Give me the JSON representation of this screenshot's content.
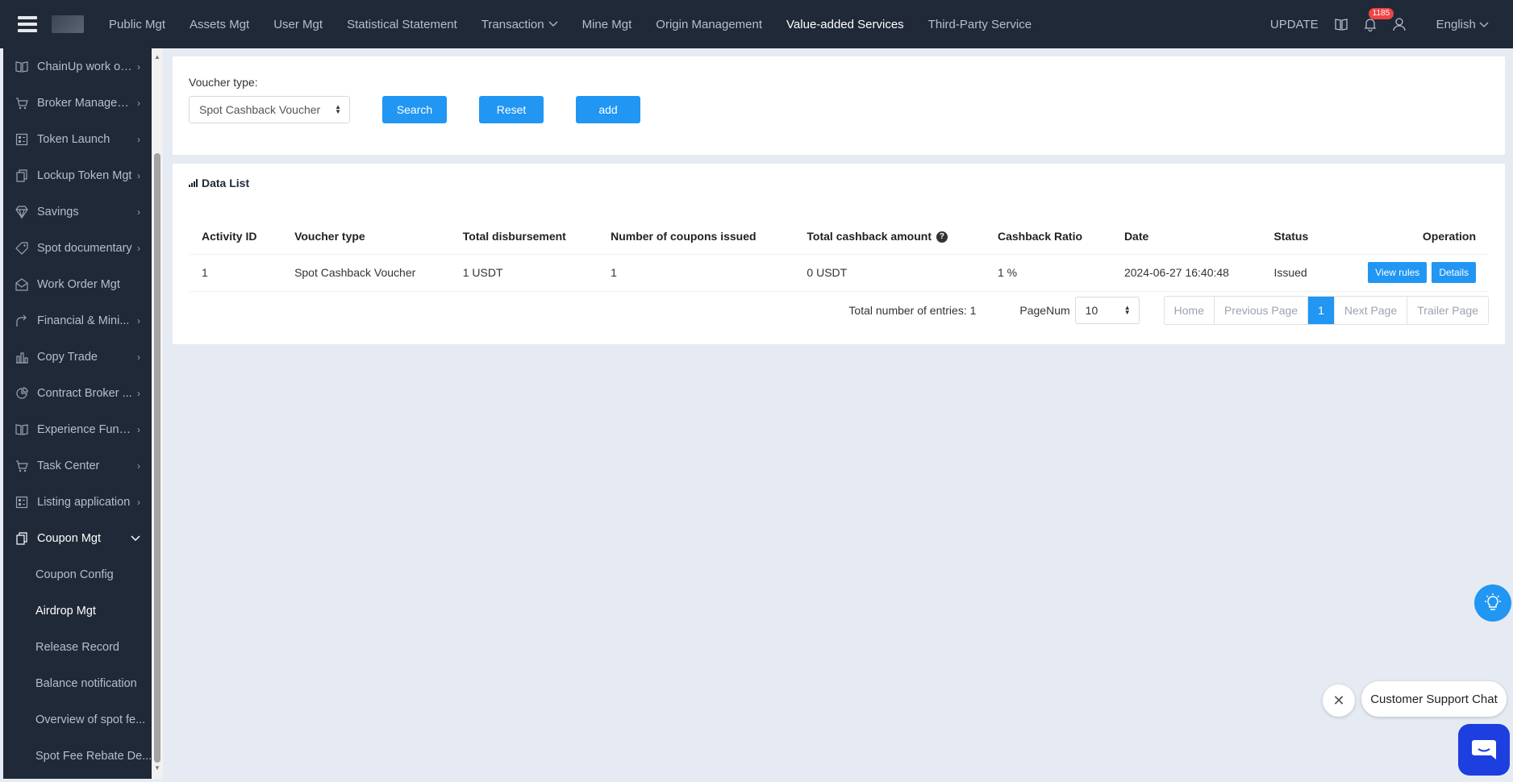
{
  "nav": {
    "items": [
      {
        "label": "Public Mgt",
        "active": false,
        "dropdown": false
      },
      {
        "label": "Assets Mgt",
        "active": false,
        "dropdown": false
      },
      {
        "label": "User Mgt",
        "active": false,
        "dropdown": false
      },
      {
        "label": "Statistical Statement",
        "active": false,
        "dropdown": false
      },
      {
        "label": "Transaction",
        "active": false,
        "dropdown": true
      },
      {
        "label": "Mine Mgt",
        "active": false,
        "dropdown": false
      },
      {
        "label": "Origin Management",
        "active": false,
        "dropdown": false
      },
      {
        "label": "Value-added Services",
        "active": true,
        "dropdown": false
      },
      {
        "label": "Third-Party Service",
        "active": false,
        "dropdown": false
      }
    ],
    "update": "UPDATE",
    "notification_count": "1185",
    "language": "English"
  },
  "sidebar": {
    "items": [
      {
        "label": "ChainUp work or...",
        "icon": "book-icon"
      },
      {
        "label": "Broker Managem...",
        "icon": "cart-icon"
      },
      {
        "label": "Token Launch",
        "icon": "grid-icon"
      },
      {
        "label": "Lockup Token Mgt",
        "icon": "copy-icon"
      },
      {
        "label": "Savings",
        "icon": "diamond-icon"
      },
      {
        "label": "Spot documentary",
        "icon": "tag-icon"
      },
      {
        "label": "Work Order Mgt",
        "icon": "mail-icon"
      },
      {
        "label": "Financial & Mini...",
        "icon": "share-icon"
      },
      {
        "label": "Copy Trade",
        "icon": "chart-icon"
      },
      {
        "label": "Contract Broker ...",
        "icon": "pie-icon"
      },
      {
        "label": "Experience Fundi...",
        "icon": "book-icon"
      },
      {
        "label": "Task Center",
        "icon": "cart-icon"
      },
      {
        "label": "Listing application",
        "icon": "grid-icon"
      }
    ],
    "open_item": {
      "label": "Coupon Mgt",
      "icon": "copy-icon"
    },
    "sub_items": [
      {
        "label": "Coupon Config",
        "active": false
      },
      {
        "label": "Airdrop Mgt",
        "active": true
      },
      {
        "label": "Release Record",
        "active": false
      },
      {
        "label": "Balance notification",
        "active": false
      },
      {
        "label": "Overview of spot fe...",
        "active": false
      },
      {
        "label": "Spot Fee Rebate De...",
        "active": false
      }
    ]
  },
  "filter": {
    "voucher_label": "Voucher type:",
    "voucher_value": "Spot Cashback Voucher",
    "search": "Search",
    "reset": "Reset",
    "add": "add"
  },
  "data_list": {
    "title": "Data List",
    "columns": [
      "Activity ID",
      "Voucher type",
      "Total disbursement",
      "Number of coupons issued",
      "Total cashback amount",
      "Cashback Ratio",
      "Date",
      "Status",
      "Operation"
    ],
    "rows": [
      {
        "id": "1",
        "voucher_type": "Spot Cashback Voucher",
        "total_disbursement": "1 USDT",
        "coupons_issued": "1",
        "total_cashback": "0 USDT",
        "ratio": "1 %",
        "date": "2024-06-27 16:40:48",
        "status": "Issued"
      }
    ],
    "view_rules": "View rules",
    "details": "Details"
  },
  "pagination": {
    "total_label": "Total number of entries:",
    "total": "1",
    "pagenum_label": "PageNum",
    "pagenum": "10",
    "home": "Home",
    "previous": "Previous Page",
    "current": "1",
    "next": "Next Page",
    "trailer": "Trailer Page"
  },
  "chat": {
    "label": "Customer Support Chat"
  }
}
